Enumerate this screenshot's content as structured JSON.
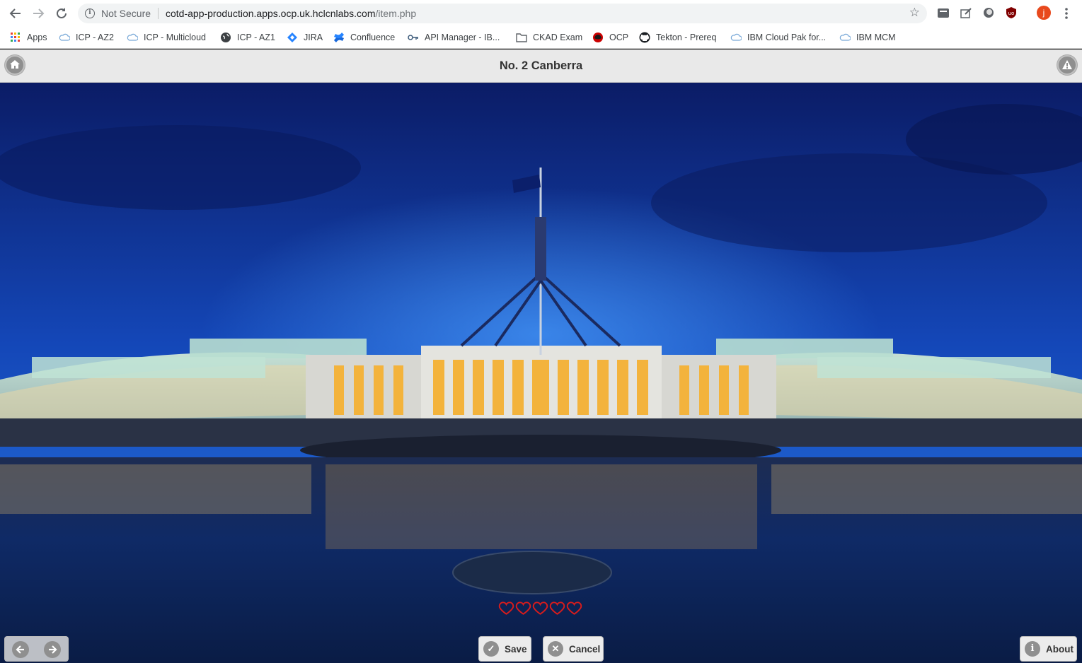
{
  "browser": {
    "security_label": "Not Secure",
    "url_host": "cotd-app-production.apps.ocp.uk.hclcnlabs.com",
    "url_path": "/item.php",
    "profile_initial": "j"
  },
  "bookmarks": [
    {
      "label": "Apps",
      "icon": "apps-grid-icon"
    },
    {
      "label": "ICP - AZ2",
      "icon": "cloud-icon"
    },
    {
      "label": "ICP - Multicloud",
      "icon": "cloud-icon"
    },
    {
      "label": "ICP - AZ1",
      "icon": "globe-icon"
    },
    {
      "label": "JIRA",
      "icon": "jira-icon"
    },
    {
      "label": "Confluence",
      "icon": "confluence-icon"
    },
    {
      "label": "API Manager - IB...",
      "icon": "key-icon"
    },
    {
      "label": "CKAD Exam",
      "icon": "folder-icon"
    },
    {
      "label": "OCP",
      "icon": "redhat-icon"
    },
    {
      "label": "Tekton - Prereq",
      "icon": "github-icon"
    },
    {
      "label": "IBM Cloud Pak for...",
      "icon": "cloud-icon"
    },
    {
      "label": "IBM MCM",
      "icon": "cloud-icon"
    }
  ],
  "page": {
    "title": "No. 2 Canberra",
    "rating": {
      "value": 0,
      "max": 5
    }
  },
  "footer": {
    "save_label": "Save",
    "cancel_label": "Cancel",
    "about_label": "About"
  },
  "colors": {
    "rating_heart": "#d81c1c",
    "sky_top": "#0d1f6b",
    "sky_bottom": "#1a6bd8"
  }
}
